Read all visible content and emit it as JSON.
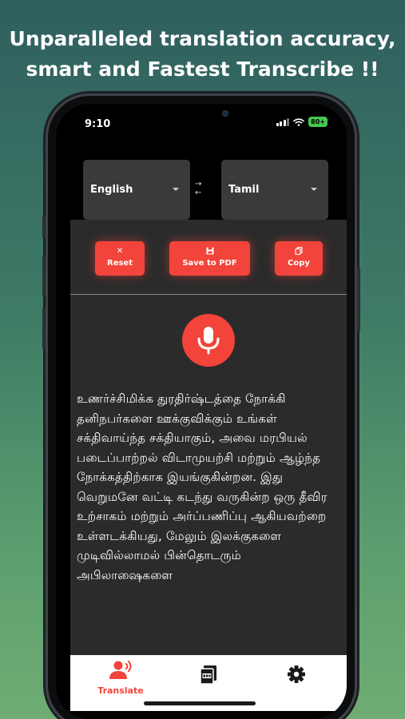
{
  "headline": {
    "line1": "Unparalleled translation accuracy,",
    "line2": "smart and Fastest Transcribe !!"
  },
  "status_bar": {
    "time": "9:10",
    "battery": "80+"
  },
  "language_picker": {
    "source": "English",
    "target": "Tamil",
    "swap_icon": "swap-arrows-icon"
  },
  "actions": {
    "reset": {
      "label": "Reset",
      "icon": "close-icon"
    },
    "save_pdf": {
      "label": "Save to PDF",
      "icon": "save-icon"
    },
    "copy": {
      "label": "Copy",
      "icon": "copy-icon"
    }
  },
  "mic": {
    "icon": "microphone-icon"
  },
  "translation_text": "உணர்ச்சிமிக்க துரதிர்ஷ்டத்தை நோக்கி தனிநபர்களை ஊக்குவிக்கும் உங்கள் சக்திவாய்ந்த சக்தியாகும், அவை மரபியல் படைப்பாற்றல் விடாமுயற்சி மற்றும் ஆழ்ந்த நோக்கத்திற்காக இயங்குகின்றன. இது வெறுமனே வட்டி கடந்து வருகின்ற ஒரு தீவிர உற்சாகம் மற்றும் அர்ப்பணிப்பு ஆகியவற்றை உள்ளடக்கியது, மேலும் இலக்குகளை முடிவில்லாமல் பின்தொடரும் அபிலாஷைகளை",
  "tabbar": {
    "translate_label": "Translate",
    "active_color": "#f2443a",
    "icons": [
      "speaker-person-icon",
      "pdf-files-icon",
      "gear-icon"
    ]
  },
  "colors": {
    "accent": "#f2443a",
    "panel": "#2b2b2b",
    "selector": "#3a3a3a"
  }
}
